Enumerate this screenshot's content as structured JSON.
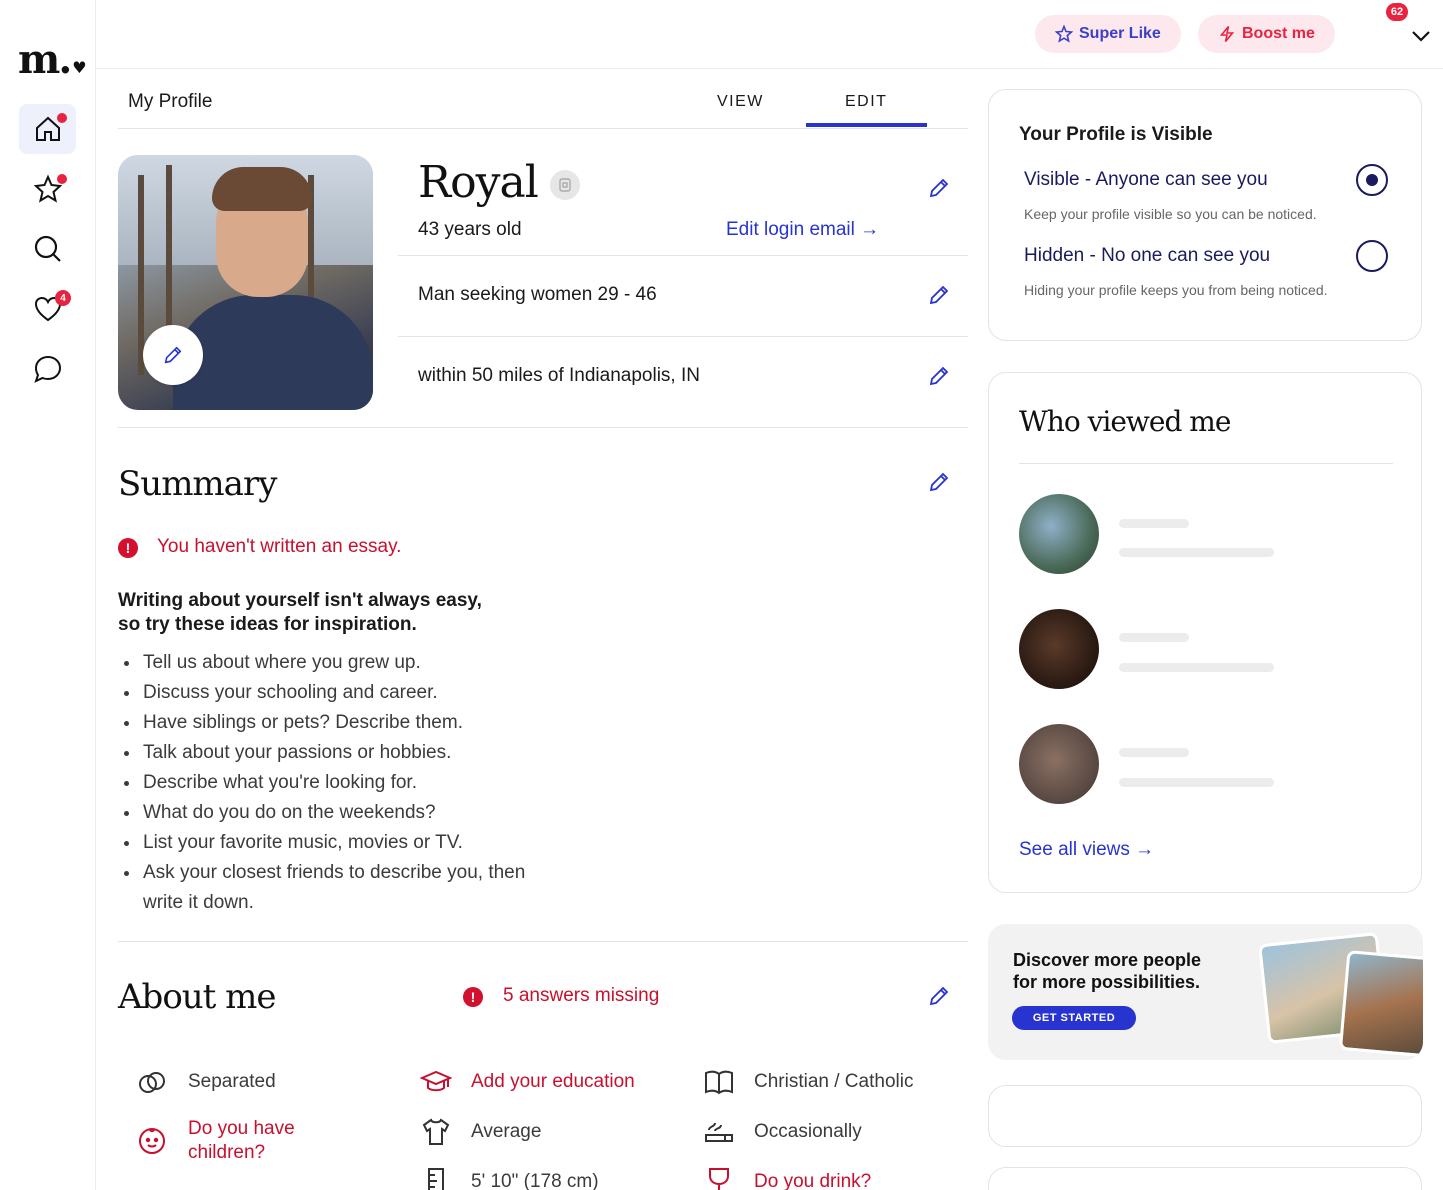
{
  "brand": {
    "logo": "m.",
    "logo_heart": "♥"
  },
  "nav": {
    "likes_badge": "4"
  },
  "topbar": {
    "super_like": "Super Like",
    "boost": "Boost me",
    "notifications": "62"
  },
  "profile": {
    "header": "My Profile",
    "tabs": [
      "VIEW",
      "EDIT"
    ],
    "name": "Royal",
    "age": "43 years old",
    "edit_login": "Edit login email →",
    "seeking": "Man seeking women 29 - 46",
    "location": "within 50 miles of Indianapolis, IN"
  },
  "summary": {
    "title": "Summary",
    "warning": "You haven't written an essay.",
    "ideas_head_1": "Writing about yourself isn't always easy,",
    "ideas_head_2": "so try these ideas for inspiration.",
    "ideas": [
      "Tell us about where you grew up.",
      "Discuss your schooling and career.",
      "Have siblings or pets? Describe them.",
      "Talk about your passions or hobbies.",
      "Describe what you're looking for.",
      "What do you do on the weekends?",
      "List your favorite music, movies or TV.",
      "Ask your closest friends to describe you, then write it down."
    ]
  },
  "about": {
    "title": "About me",
    "missing": "5 answers missing",
    "items": [
      {
        "text": "Separated",
        "icon": "rings-icon",
        "missing": false
      },
      {
        "text": "Add your education",
        "icon": "graduation-cap-icon",
        "missing": true
      },
      {
        "text": "Christian / Catholic",
        "icon": "open-book-icon",
        "missing": false
      },
      {
        "text": "Do you have children?",
        "icon": "baby-face-icon",
        "missing": true
      },
      {
        "text": "Average",
        "icon": "shirt-icon",
        "missing": false
      },
      {
        "text": "Occasionally",
        "icon": "smoking-icon",
        "missing": false
      },
      {
        "text": "5' 10\" (178 cm)",
        "icon": "ruler-icon",
        "missing": false
      },
      {
        "text": "Do you drink?",
        "icon": "wine-glass-icon",
        "missing": true
      }
    ]
  },
  "visibility": {
    "title": "Your Profile is Visible",
    "visible_label": "Visible - Anyone can see you",
    "visible_sub": "Keep your profile visible so you can be noticed.",
    "hidden_label": "Hidden - No one can see you",
    "hidden_sub": "Hiding your profile keeps you from being noticed.",
    "selected": "visible"
  },
  "who_viewed": {
    "title": "Who viewed me",
    "see_all": "See all views →"
  },
  "promo": {
    "line1": "Discover more people",
    "line2": "for more possibilities.",
    "button": "GET STARTED"
  },
  "colors": {
    "accent": "#2734d0",
    "alert": "#c8102e",
    "badge": "#e8233f"
  }
}
